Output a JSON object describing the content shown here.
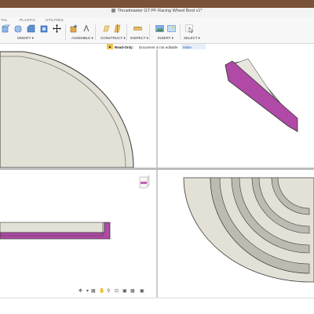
{
  "window": {
    "title": "Thrustmaster GT PF Racing Wheel Boot v1*"
  },
  "ribbon": {
    "tabs": [
      {
        "label": "TAL",
        "active": false
      },
      {
        "label": "PLASTIC",
        "active": false
      },
      {
        "label": "UTILITIES",
        "active": false
      }
    ],
    "groups": {
      "modify": "MODIFY ▾",
      "assemble": "ASSEMBLE ▾",
      "construct": "CONSTRUCT ▾",
      "inspect": "INSPECT ▾",
      "insert": "INSERT ▾",
      "select": "SELECT ▾"
    }
  },
  "notice": {
    "lock_icon": "lock-icon",
    "status": "Read-Only:",
    "message": "Document is not editable",
    "action": "Make Editable"
  },
  "viewcube": {
    "label": "FRONT"
  },
  "colors": {
    "brand_band": "#7a5139",
    "surface": "#e3e0d6",
    "edge": "#3a3a3a",
    "section_hatch": "#b04aa6",
    "accent": "#2d62c7"
  }
}
